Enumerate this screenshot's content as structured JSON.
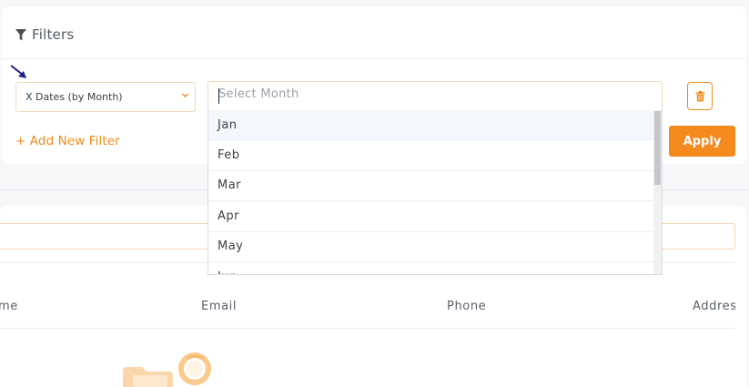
{
  "filters": {
    "title": "Filters",
    "field_select_value": "X Dates (by Month)",
    "month_placeholder": "Select Month",
    "add_filter_label": "+ Add New Filter",
    "apply_label": "Apply",
    "month_options": [
      "Jan",
      "Feb",
      "Mar",
      "Apr",
      "May",
      "Jun"
    ]
  },
  "table": {
    "columns": [
      "me",
      "Email",
      "Phone",
      "Address"
    ]
  },
  "colors": {
    "accent": "#f58a1f",
    "input_border": "#f2d8b6"
  }
}
